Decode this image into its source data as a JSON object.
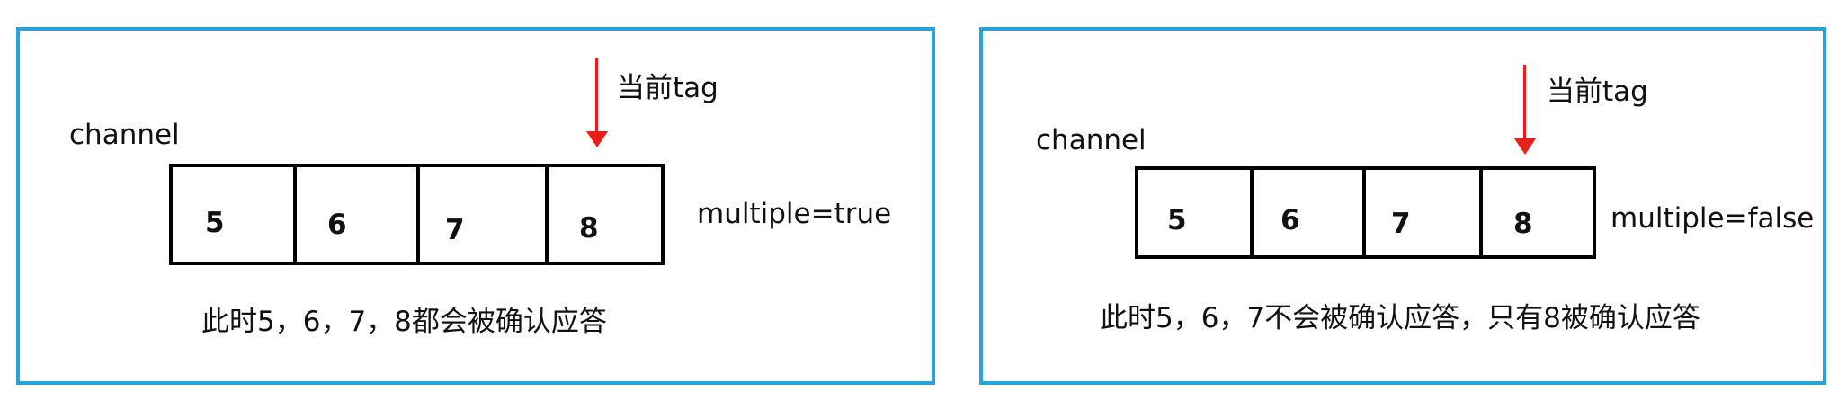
{
  "left": {
    "channel_label": "channel",
    "current_tag_label": "当前tag",
    "cells": [
      "5",
      "6",
      "7",
      "8"
    ],
    "multiple_label": "multiple=true",
    "caption": "此时5，6，7，8都会被确认应答"
  },
  "right": {
    "channel_label": "channel",
    "current_tag_label": "当前tag",
    "cells": [
      "5",
      "6",
      "7",
      "8"
    ],
    "multiple_label": "multiple=false",
    "caption": "此时5，6，7不会被确认应答，只有8被确认应答"
  },
  "colors": {
    "panel_border": "#29a3dc",
    "arrow": "#e8201b",
    "cell_border": "#000000"
  }
}
